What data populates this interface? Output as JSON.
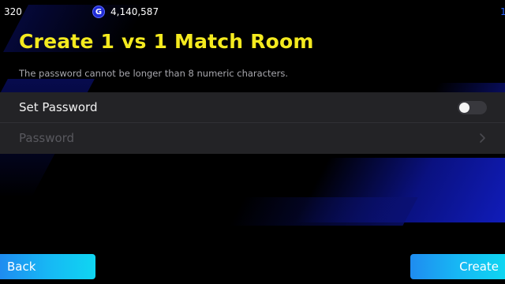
{
  "status_bar": {
    "coins": "320",
    "gp_icon_letter": "G",
    "gp_value": "4,140,587",
    "edge_mark": "1"
  },
  "header": {
    "title": "Create 1 vs 1 Match Room",
    "subtitle": "The password cannot be longer than 8 numeric characters."
  },
  "settings": {
    "set_password_label": "Set Password",
    "set_password_enabled": false,
    "password_label": "Password",
    "password_enabled": false
  },
  "footer": {
    "back_label": "Back",
    "create_label": "Create"
  },
  "colors": {
    "title": "#f4ea1f",
    "accent_blue": "#1f2bd6",
    "button_gradient_start": "#1f8cf0",
    "button_gradient_end": "#0fd6f2"
  },
  "icons": {
    "gp": "gp-coin-icon",
    "chevron": "chevron-right-icon"
  }
}
